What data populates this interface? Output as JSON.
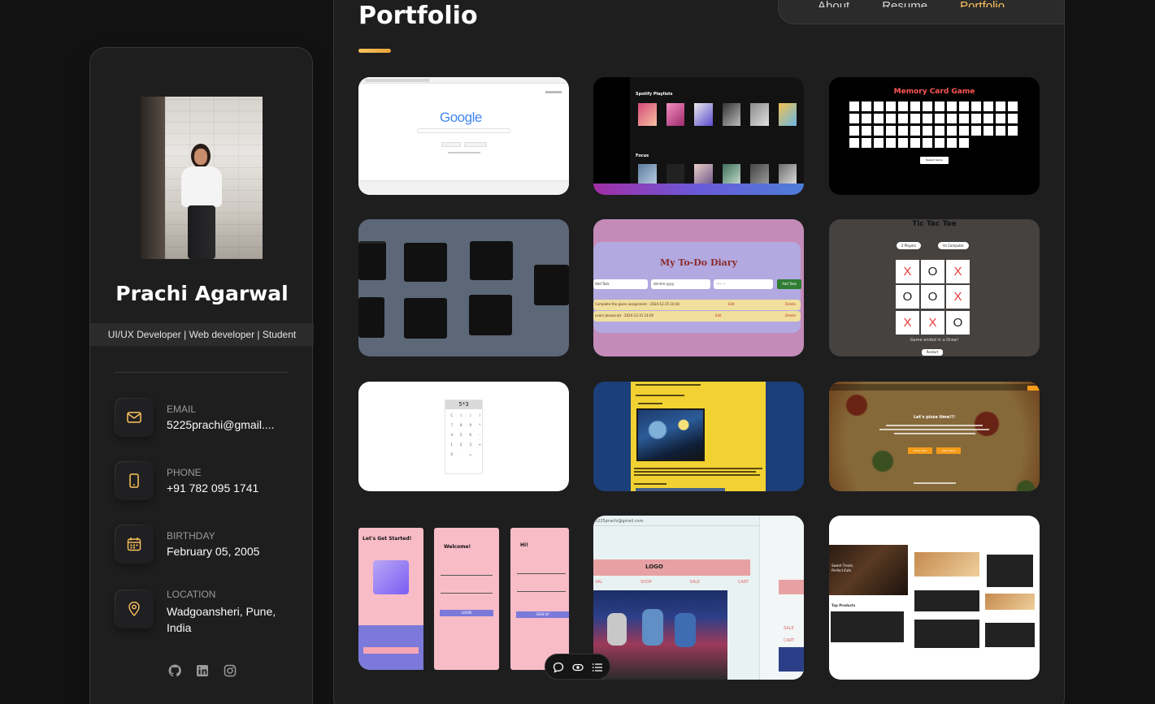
{
  "profile": {
    "name": "Prachi Agarwal",
    "title": "UI/UX Developer | Web developer | Student"
  },
  "contacts": [
    {
      "label": "EMAIL",
      "value": "5225prachi@gmail....",
      "icon": "mail-icon"
    },
    {
      "label": "PHONE",
      "value": "+91 782 095 1741",
      "icon": "phone-icon"
    },
    {
      "label": "BIRTHDAY",
      "value": "February 05, 2005",
      "icon": "calendar-icon"
    },
    {
      "label": "LOCATION",
      "value": "Wadgoansheri, Pune, India",
      "icon": "location-icon"
    }
  ],
  "socials": [
    "github-icon",
    "linkedin-icon",
    "instagram-icon"
  ],
  "nav": {
    "items": [
      "About",
      "Resume",
      "Portfolio"
    ],
    "active": "Portfolio"
  },
  "page": {
    "title": "Portfolio"
  },
  "tiles": {
    "google": {
      "logo": "Google"
    },
    "spotify": {
      "heading": "Spotify Playlists",
      "subheading": "Focus"
    },
    "memory": {
      "title": "Memory Card Game",
      "button": "Restart Game"
    },
    "todo": {
      "title": "My To-Do Diary",
      "add_button": "Add Task",
      "input": "Add Task",
      "date": "dd-mm-yyyy",
      "time": "--:-- --",
      "task1": "Complete the given assignment - 2024-12-25 10:30",
      "task2": "Learn Javascript - 2024-12-31 14:00",
      "edit": "Edit",
      "delete": "Delete"
    },
    "ttt": {
      "title": "Tic Tac Toe",
      "mode1": "2 Players",
      "mode2": "Vs Computer",
      "board": [
        "X",
        "O",
        "X",
        "O",
        "O",
        "X",
        "X",
        "X",
        "O"
      ],
      "status": "Game ended in a Draw!",
      "restart": "Restart"
    },
    "calc": {
      "display": "5*3",
      "keys": [
        "C",
        "(",
        ")",
        "/",
        "7",
        "8",
        "9",
        "*",
        "4",
        "5",
        "6",
        "-",
        "1",
        "2",
        "3",
        "+",
        "0",
        ".",
        "=",
        ""
      ]
    },
    "pizza": {
      "headline": "Let's pizza time!!!",
      "btn1": "Order Now",
      "btn2": "Learn More"
    },
    "signup": {
      "s1_title": "Let's Get Started!",
      "s2_title": "Welcome!",
      "s3_title": "Hi!",
      "login": "LOGIN",
      "signup": "SIGN UP"
    },
    "shop": {
      "logo": "LOGO",
      "menu": [
        "VAL",
        "SHOP",
        "SALE",
        "CART"
      ],
      "email": "5225prachi@gmail.com",
      "side": [
        "SALE",
        "CART"
      ]
    },
    "bakery": {
      "headline": "Sweet Treats, Perfect Eats",
      "section": "Top Products"
    }
  },
  "colors": {
    "accent": "#ffc35d",
    "panel": "#1e1e1f",
    "bg": "#121212"
  }
}
